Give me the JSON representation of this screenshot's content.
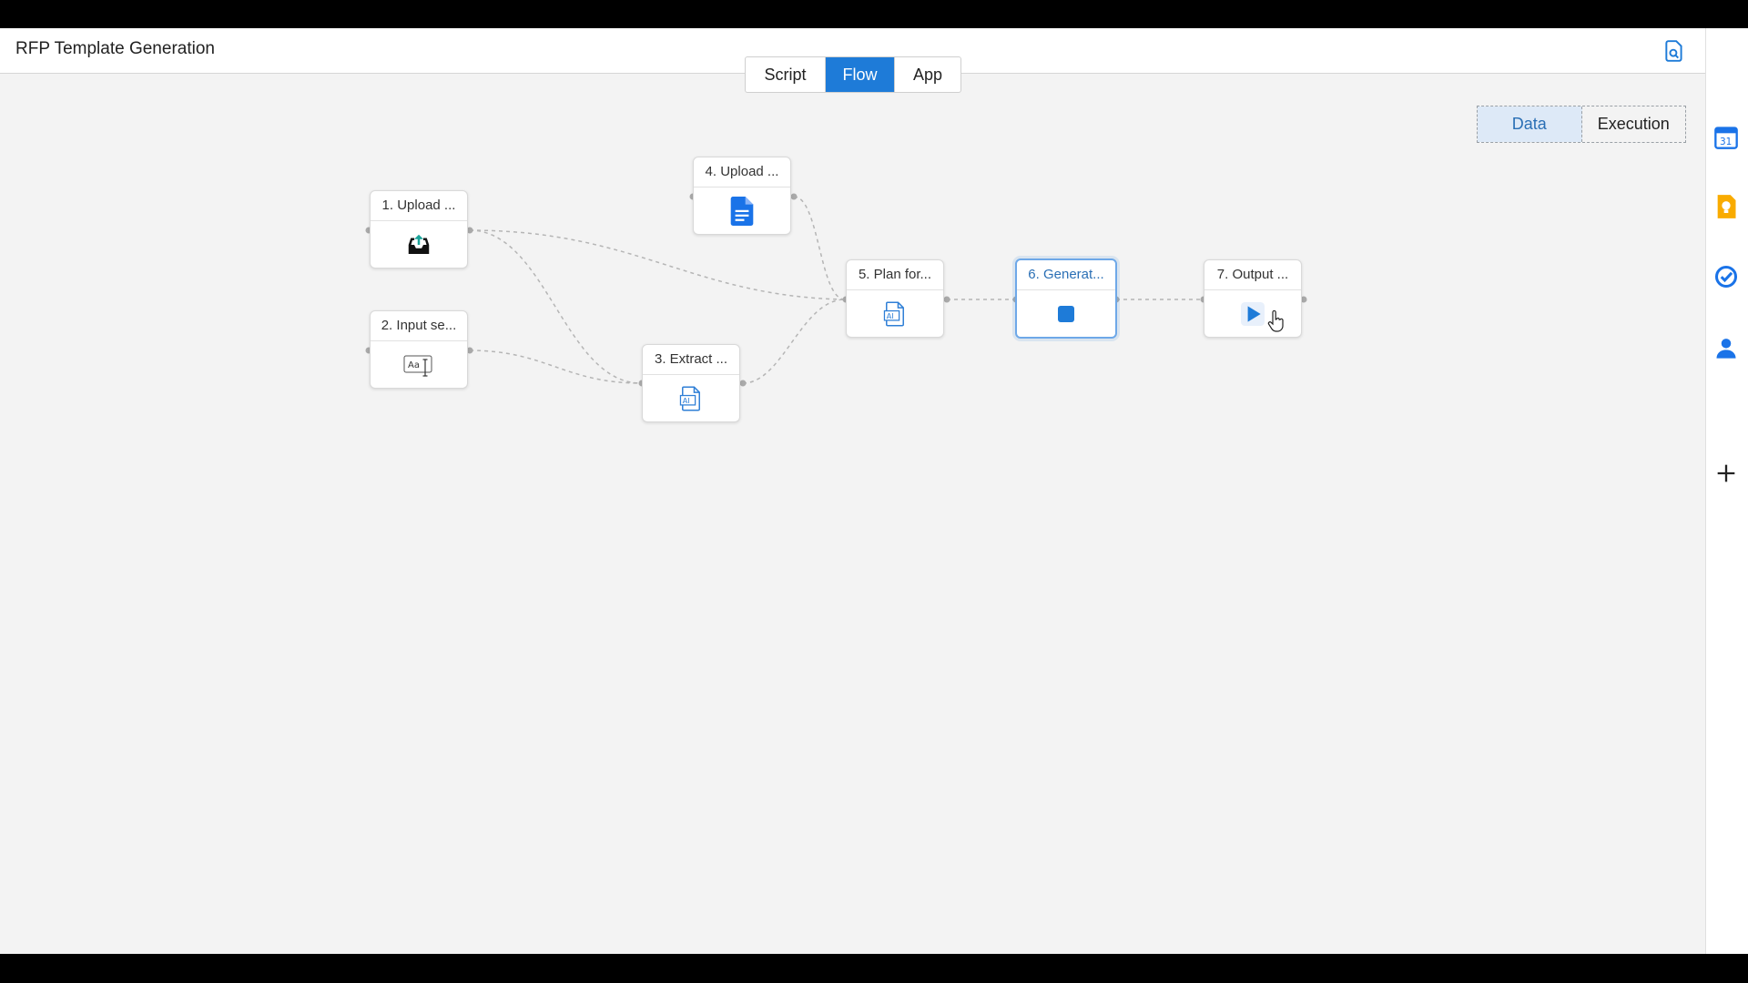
{
  "header": {
    "title": "RFP Template Generation"
  },
  "tabs": [
    {
      "label": "Script",
      "active": false
    },
    {
      "label": "Flow",
      "active": true
    },
    {
      "label": "App",
      "active": false
    }
  ],
  "view_toggle": [
    {
      "label": "Data",
      "active": true
    },
    {
      "label": "Execution",
      "active": false
    }
  ],
  "nodes": [
    {
      "label": "1. Upload ...",
      "icon": "upload-inbox-icon"
    },
    {
      "label": "2. Input se...",
      "icon": "text-input-icon"
    },
    {
      "label": "3. Extract ...",
      "icon": "ai-document-icon"
    },
    {
      "label": "4. Upload ...",
      "icon": "google-doc-icon"
    },
    {
      "label": "5. Plan for...",
      "icon": "ai-document-icon"
    },
    {
      "label": "6. Generat...",
      "icon": "stop-square-icon",
      "selected": true
    },
    {
      "label": "7. Output ...",
      "icon": "play-icon"
    }
  ],
  "right_rail": [
    "google-calendar-icon",
    "google-keep-icon",
    "google-tasks-icon",
    "contacts-icon",
    "add-icon"
  ],
  "colors": {
    "accent": "#1e7bd8",
    "canvas": "#f3f3f3",
    "edge": "#b5b5b5"
  }
}
